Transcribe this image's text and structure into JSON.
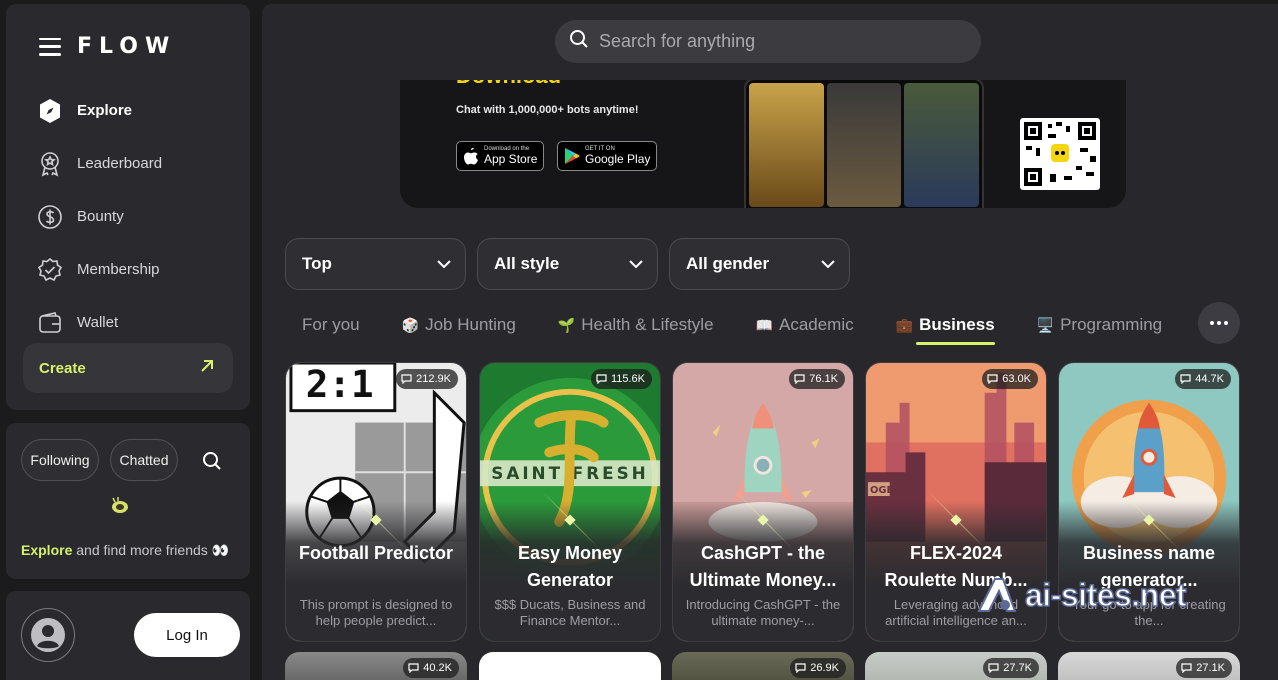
{
  "app": {
    "logo": "FLOW"
  },
  "sidebar": {
    "items": [
      {
        "label": "Explore",
        "icon": "compass-icon",
        "active": true
      },
      {
        "label": "Leaderboard",
        "icon": "medal-icon"
      },
      {
        "label": "Bounty",
        "icon": "dollar-icon"
      },
      {
        "label": "Membership",
        "icon": "badge-check-icon"
      },
      {
        "label": "Wallet",
        "icon": "wallet-icon"
      }
    ],
    "create_label": "Create"
  },
  "friends": {
    "following_label": "Following",
    "chatted_label": "Chatted",
    "explore_link": "Explore",
    "explore_rest": " and find more friends 👀"
  },
  "auth": {
    "login_label": "Log In"
  },
  "search": {
    "placeholder": "Search for anything"
  },
  "banner": {
    "title": "Download",
    "subtitle": "Chat with 1,000,000+ bots anytime!",
    "appstore_small": "Download on the",
    "appstore_big": "App Store",
    "googleplay_small": "GET IT ON",
    "googleplay_big": "Google Play"
  },
  "filters": [
    "Top",
    "All style",
    "All gender"
  ],
  "tabs": [
    {
      "label": "For you",
      "emoji": ""
    },
    {
      "label": "Job Hunting",
      "emoji": "🎲"
    },
    {
      "label": "Health & Lifestyle",
      "emoji": "🌱"
    },
    {
      "label": "Academic",
      "emoji": "📖"
    },
    {
      "label": "Business",
      "emoji": "💼",
      "active": true
    },
    {
      "label": "Programming",
      "emoji": "🖥️"
    }
  ],
  "cards": [
    {
      "title": "Football Predictor",
      "desc": "This prompt is designed to help people predict...",
      "count": "212.9K"
    },
    {
      "title": "Easy Money Generator",
      "desc": "$$$ Ducats, Business and Finance Mentor...",
      "count": "115.6K",
      "art_text": "SAINT FRESH"
    },
    {
      "title": "CashGPT - the Ultimate Money...",
      "desc": "Introducing CashGPT - the ultimate money-...",
      "count": "76.1K"
    },
    {
      "title": "FLEX-2024 Roulette Numb...",
      "desc": "Leveraging advanced artificial intelligence an...",
      "count": "63.0K"
    },
    {
      "title": "Business name generator...",
      "desc": "Your go-to app for creating the...",
      "count": "44.7K"
    }
  ],
  "row2_counts": [
    "40.2K",
    "",
    "26.9K",
    "27.7K",
    "27.1K"
  ],
  "watermark": "ai-sites.net",
  "colors": {
    "accent": "#d6f26a",
    "bg": "#1b1b1e",
    "panel": "#2a2a2e"
  }
}
